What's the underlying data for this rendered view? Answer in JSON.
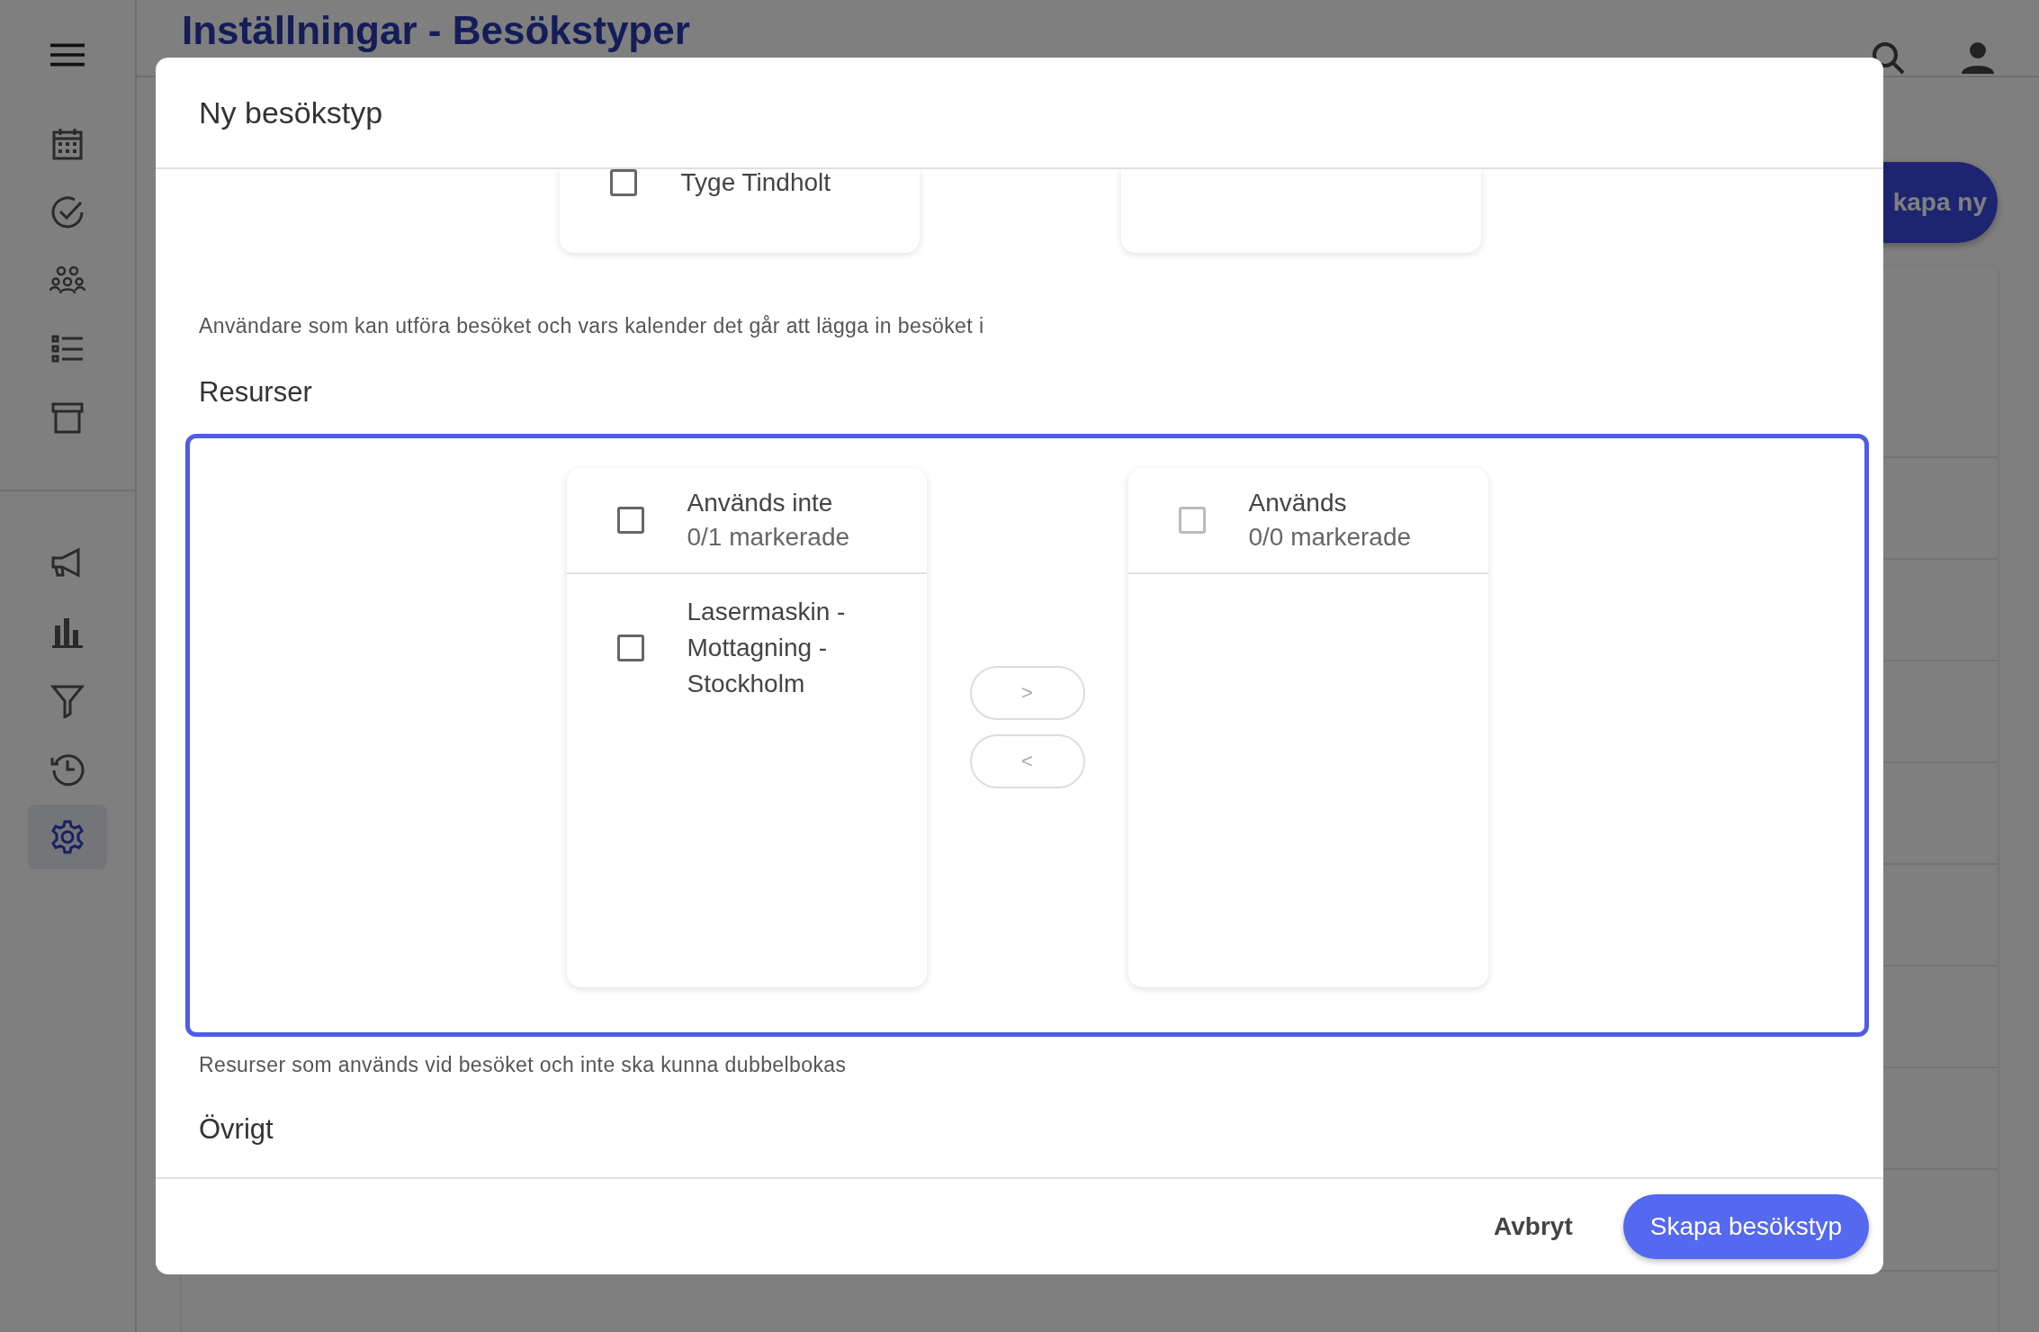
{
  "sidebar": {
    "items": [
      {
        "selected": false
      },
      {
        "selected": false
      },
      {
        "selected": false
      },
      {
        "selected": false
      },
      {
        "selected": false
      },
      {
        "selected": false
      },
      {
        "selected": false
      },
      {
        "selected": false
      },
      {
        "selected": false
      },
      {
        "selected": true
      }
    ]
  },
  "page": {
    "title": "Inställningar - Besökstyper",
    "create_button": "kapa ny"
  },
  "dialog": {
    "title": "Ny besökstyp",
    "users": {
      "left_items": [
        {
          "label": "Tyge Tindholt",
          "checked": false
        }
      ],
      "helper": "Användare som kan utföra besöket och vars kalender det går att lägga in besöket i"
    },
    "resources": {
      "title": "Resurser",
      "focused": true,
      "left": {
        "title": "Används inte",
        "count": "0/1 markerade",
        "all_checked": false,
        "disabled": false,
        "items": [
          {
            "label": "Lasermaskin - Mottagning - Stockholm",
            "checked": false
          }
        ]
      },
      "right": {
        "title": "Används",
        "count": "0/0 markerade",
        "all_checked": false,
        "disabled": true
      },
      "move_buttons": [
        {
          "label": ">",
          "disabled": true
        },
        {
          "label": "<",
          "disabled": true
        }
      ],
      "helper": "Resurser som används vid besöket och inte ska kunna dubbelbokas"
    },
    "other": {
      "title": "Övrigt"
    },
    "buttons": [
      {
        "label": "Avbryt",
        "kind": "text"
      },
      {
        "label": "Skapa besökstyp",
        "kind": "primary"
      }
    ]
  }
}
